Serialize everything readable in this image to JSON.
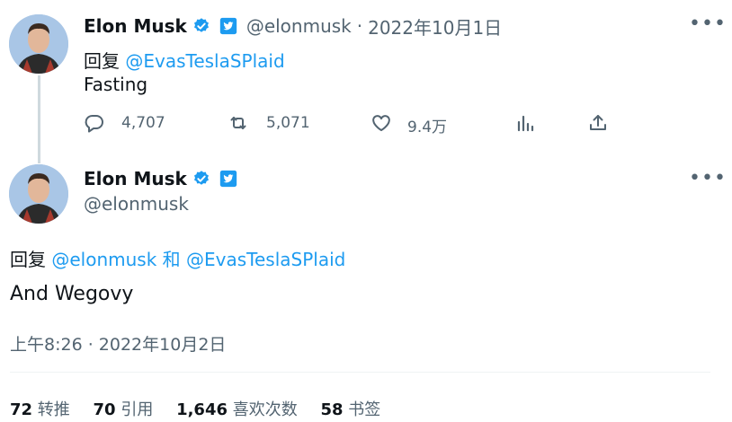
{
  "tweet1": {
    "name": "Elon Musk",
    "handle": "@elonmusk",
    "sep": "·",
    "date": "2022年10月1日",
    "reply_prefix": "回复",
    "reply_to": "@EvasTeslaSPlaid",
    "text": "Fasting",
    "actions": {
      "replies": "4,707",
      "retweets": "5,071",
      "likes": "9.4万"
    }
  },
  "tweet2": {
    "name": "Elon Musk",
    "handle": "@elonmusk",
    "reply_prefix": "回复",
    "reply_to_1": "@elonmusk",
    "reply_and": "和",
    "reply_to_2": "@EvasTeslaSPlaid",
    "text": "And Wegovy",
    "timestamp": "上午8:26 · 2022年10月2日",
    "stats": {
      "retweets_count": "72",
      "retweets_label": "转推",
      "quotes_count": "70",
      "quotes_label": "引用",
      "likes_count": "1,646",
      "likes_label": "喜欢次数",
      "bookmarks_count": "58",
      "bookmarks_label": "书签"
    }
  },
  "colors": {
    "accent": "#1d9bf0",
    "verified": "#1d9bf0",
    "muted": "#536471",
    "text": "#0f1419"
  }
}
